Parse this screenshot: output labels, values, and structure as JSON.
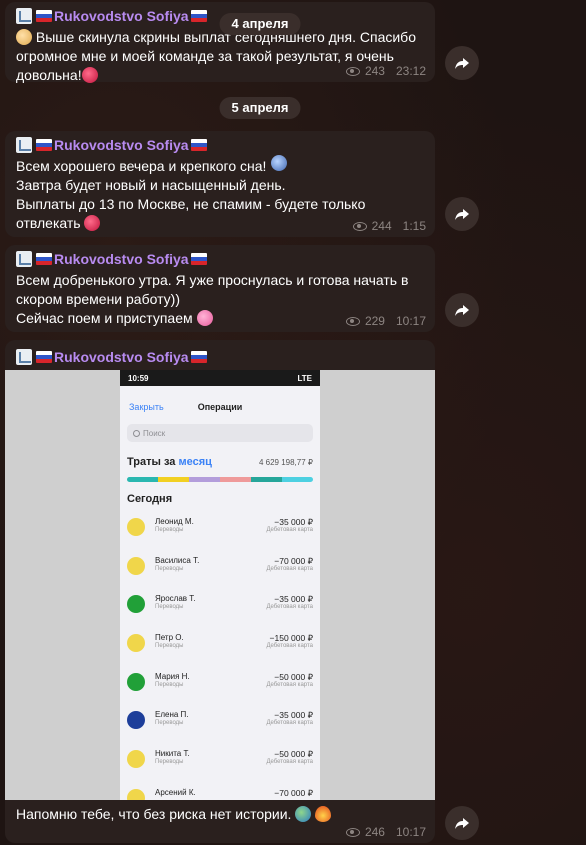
{
  "channel": {
    "sender_name": "Rukovodstvo Sofiya"
  },
  "date_dividers": [
    "4 апреля",
    "5 апреля"
  ],
  "messages": [
    {
      "text_before": "",
      "text": " Выше скинула скрины выплат сегодняшнего дня. Спасибо огромное мне и моей команде за такой результат, я очень довольна!",
      "views": "243",
      "time": "23:12"
    },
    {
      "text": "Всем хорошего вечера и крепкого сна!\nЗавтра будет новый и насыщенный день.\nВыплаты до 13 по Москве, не спамим - будете только отвлекать",
      "views": "244",
      "time": "1:15"
    },
    {
      "text": "Всем добренького утра. Я уже проснулась и готова начать в скором времени работу))\nСейчас  поем и приступаем",
      "views": "229",
      "time": "10:17"
    },
    {
      "text": "Напомню тебе, что без риска нет истории.",
      "views": "246",
      "time": "10:17"
    }
  ],
  "phone": {
    "status_time": "10:59",
    "status_right": "LTE",
    "close_label": "Закрыть",
    "title": "Операции",
    "search_placeholder": "Поиск",
    "spend_label": "Траты за",
    "spend_period": "месяц",
    "spend_total": "4 629 198,77 ₽",
    "today_label": "Сегодня",
    "category_colors": [
      "#2ab7b0",
      "#f2d022",
      "#b39ddb",
      "#ef9a9a",
      "#26a69a",
      "#4dd0e1"
    ],
    "transactions": [
      {
        "name": "Леонид М.",
        "type": "Переводы",
        "amount": "−35 000 ₽",
        "card": "Дебетовая карта",
        "icon_color": "#f0d64a"
      },
      {
        "name": "Василиса Т.",
        "type": "Переводы",
        "amount": "−70 000 ₽",
        "card": "Дебетовая карта",
        "icon_color": "#f0d64a"
      },
      {
        "name": "Ярослав Т.",
        "type": "Переводы",
        "amount": "−35 000 ₽",
        "card": "Дебетовая карта",
        "icon_color": "#21a038"
      },
      {
        "name": "Петр О.",
        "type": "Переводы",
        "amount": "−150 000 ₽",
        "card": "Дебетовая карта",
        "icon_color": "#f0d64a"
      },
      {
        "name": "Мария Н.",
        "type": "Переводы",
        "amount": "−50 000 ₽",
        "card": "Дебетовая карта",
        "icon_color": "#21a038"
      },
      {
        "name": "Елена П.",
        "type": "Переводы",
        "amount": "−35 000 ₽",
        "card": "Дебетовая карта",
        "icon_color": "#1d3e9a"
      },
      {
        "name": "Никита Т.",
        "type": "Переводы",
        "amount": "−50 000 ₽",
        "card": "Дебетовая карта",
        "icon_color": "#f0d64a"
      },
      {
        "name": "Арсений К.",
        "type": "",
        "amount": "−70 000 ₽",
        "card": "",
        "icon_color": "#f0d64a"
      }
    ]
  }
}
